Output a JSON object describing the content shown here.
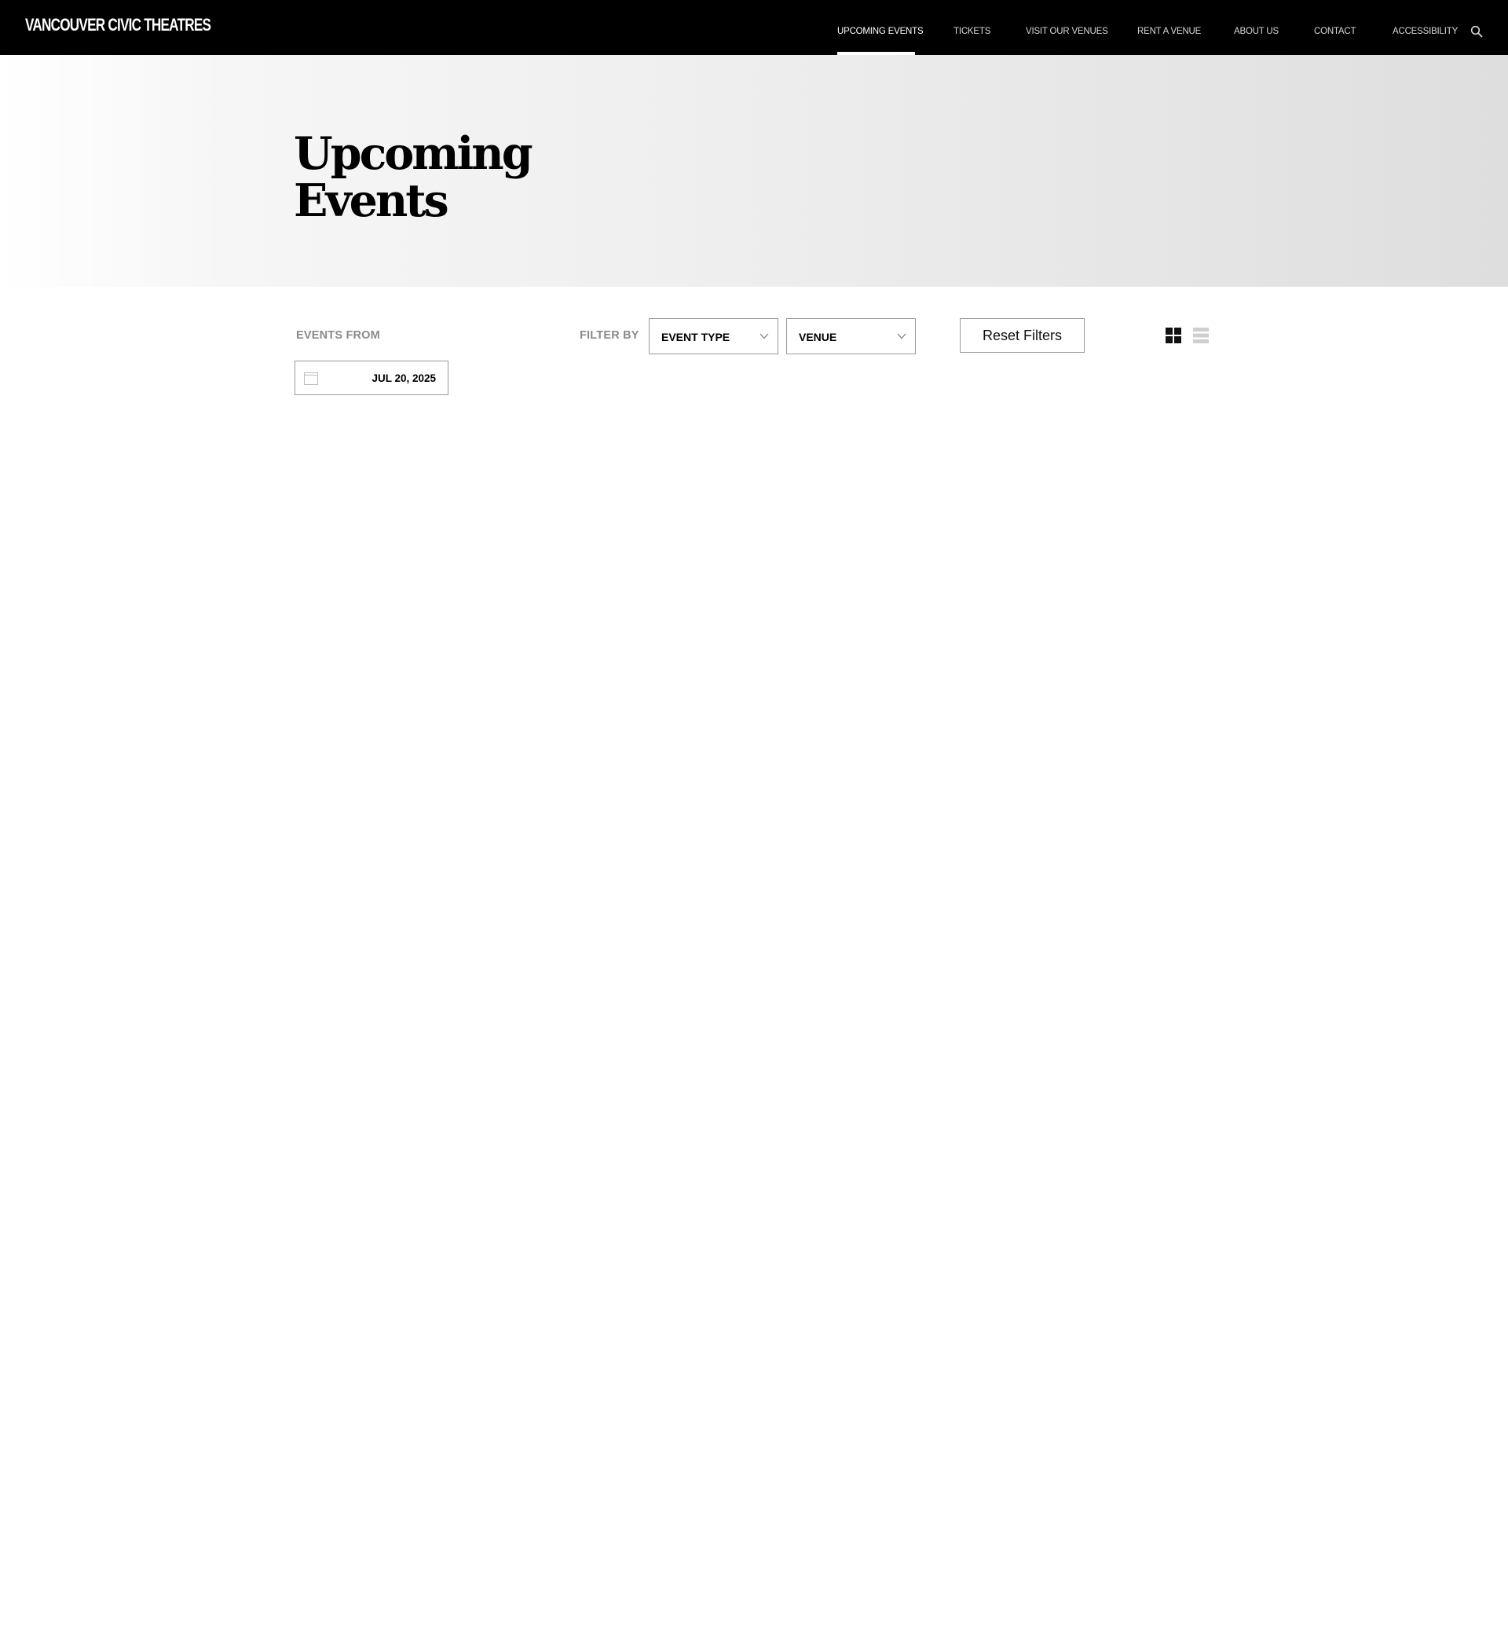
{
  "header": {
    "logo_text": "VANCOUVER CIVIC THEATRES",
    "nav": [
      {
        "label": "UPCOMING EVENTS",
        "active": true
      },
      {
        "label": "TICKETS",
        "active": false
      },
      {
        "label": "VISIT OUR VENUES",
        "active": false
      },
      {
        "label": "RENT A VENUE",
        "active": false
      },
      {
        "label": "ABOUT US",
        "active": false
      },
      {
        "label": "CONTACT",
        "active": false
      },
      {
        "label": "ACCESSIBILITY",
        "active": false
      }
    ],
    "search_icon": "search-icon"
  },
  "hero": {
    "title_line1": "Upcoming",
    "title_line2": "Events"
  },
  "filters": {
    "events_from_label": "EVENTS FROM",
    "date_value": "JUL 20, 2025",
    "date_icon": "calendar-icon",
    "filter_by_label": "FILTER BY",
    "event_type_label": "EVENT TYPE",
    "venue_label": "VENUE",
    "reset_label": "Reset Filters",
    "view_modes": [
      {
        "name": "grid-view-icon",
        "active": true
      },
      {
        "name": "list-view-icon",
        "active": false
      }
    ]
  },
  "colors": {
    "header_bg": "#000000",
    "accent": "#ffffff",
    "muted_label": "#8a8a8a",
    "inactive_icon": "#cfcfcf"
  }
}
